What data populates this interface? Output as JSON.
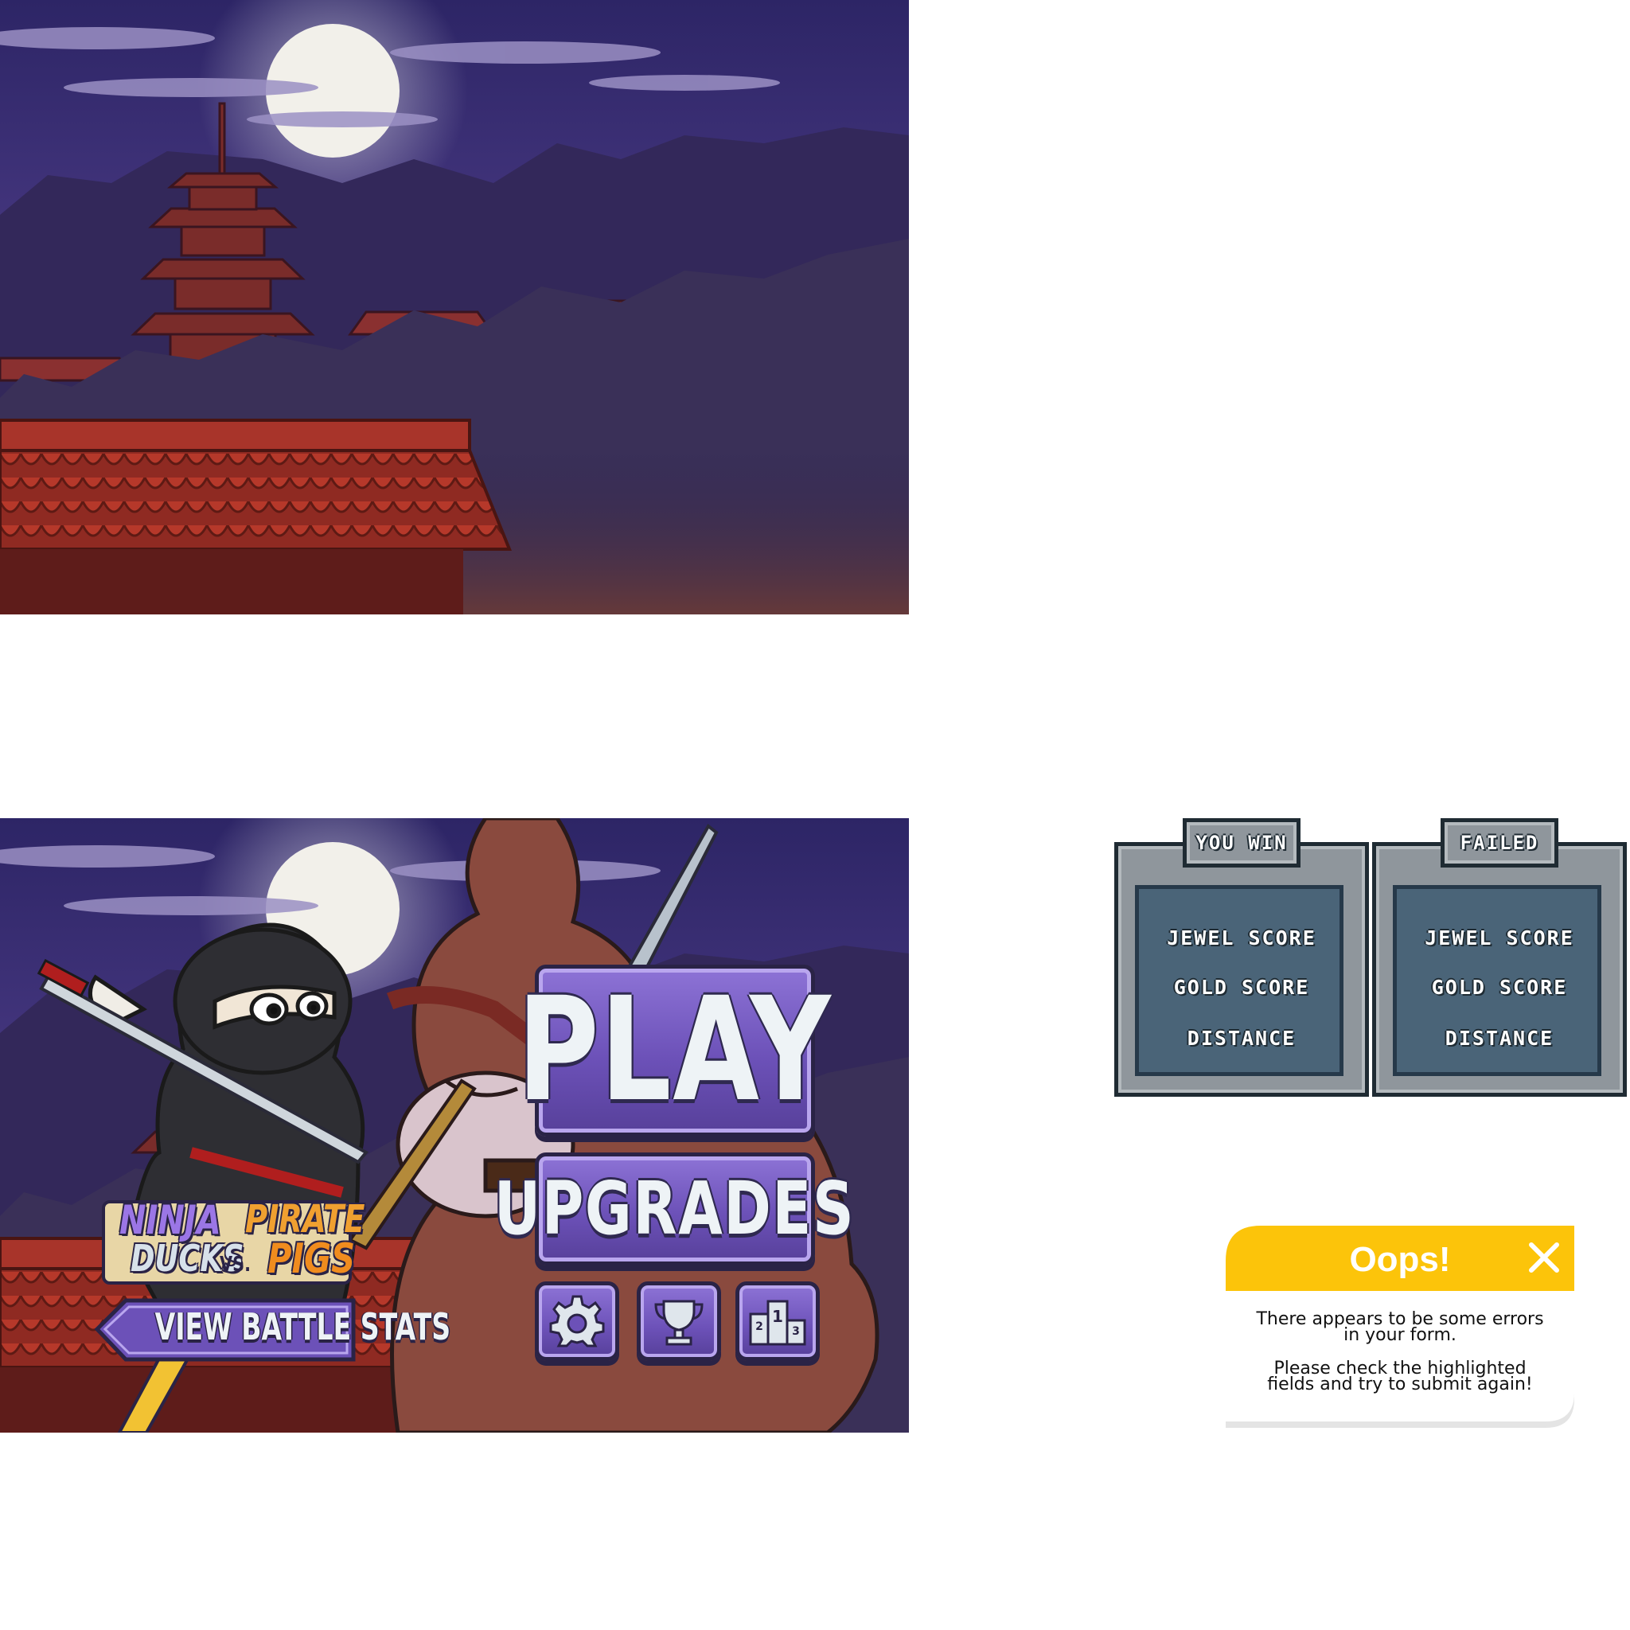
{
  "menu": {
    "play_label": "PLAY",
    "upgrades_label": "UPGRADES",
    "battle_stats_label": "VIEW BATTLE STATS",
    "icon_buttons": [
      "gear-icon",
      "trophy-icon",
      "podium-icon"
    ],
    "podium_places": [
      "1",
      "2",
      "3"
    ]
  },
  "logo": {
    "ninja": "NINJA",
    "ducks": "DUCKS",
    "vs": "VS.",
    "pirate": "PIRATE",
    "pigs": "PIGS"
  },
  "panels": [
    {
      "title": "YOU WIN",
      "rows": [
        "JEWEL SCORE",
        "GOLD SCORE",
        "DISTANCE"
      ]
    },
    {
      "title": "FAILED",
      "rows": [
        "JEWEL SCORE",
        "GOLD SCORE",
        "DISTANCE"
      ]
    }
  ],
  "dialog": {
    "title": "Oops!",
    "line1": "There appears to be some errors in your form.",
    "line2": "Please check the highlighted fields and try to submit again!",
    "close_icon": "close-icon"
  },
  "colors": {
    "sky": "#3a2f6e",
    "moon": "#f2f0ea",
    "roof": "#b6382a",
    "button_purple": "#6c51b8",
    "panel_grey": "#8f969c",
    "panel_inner": "#4a6478",
    "dialog_yellow": "#fcc40a"
  }
}
